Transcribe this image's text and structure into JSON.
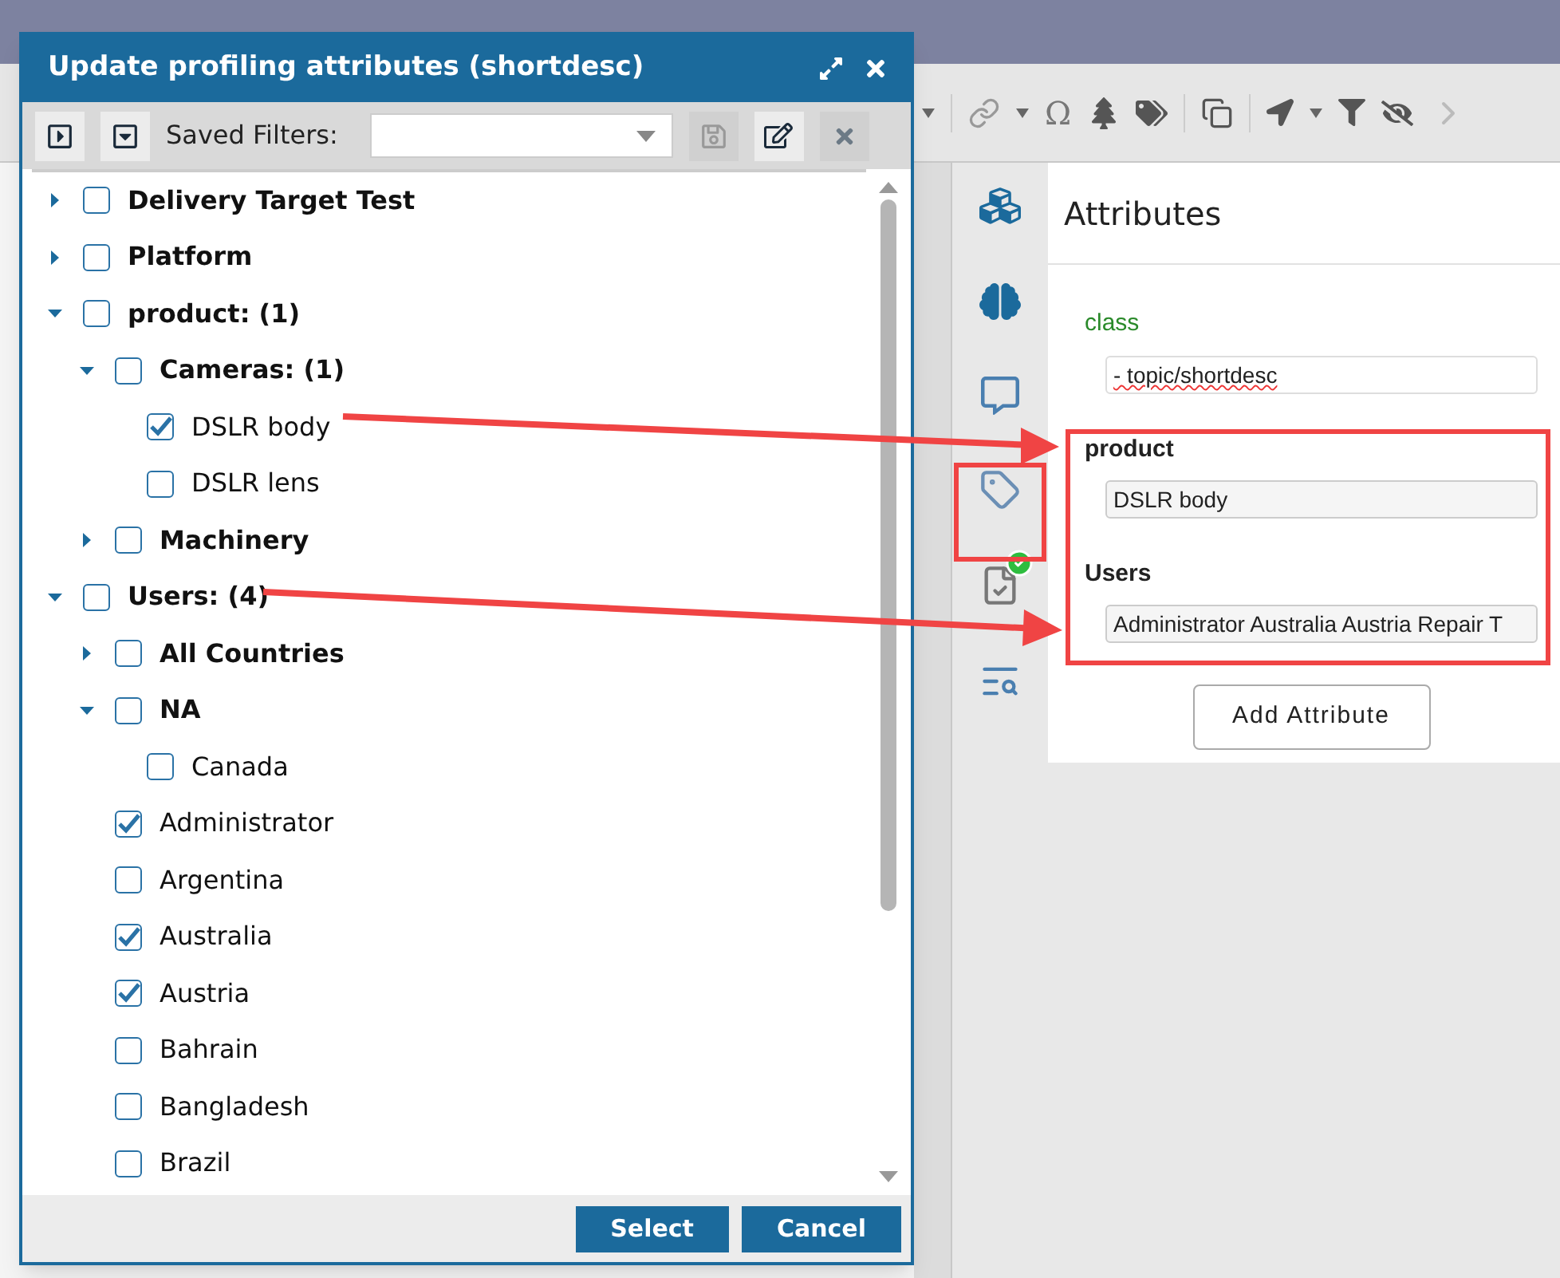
{
  "dialog": {
    "title": "Update profiling attributes (shortdesc)",
    "saved_filters_label": "Saved Filters:",
    "tree": [
      {
        "label": "Delivery Target Test",
        "kind": "group",
        "expanded": false,
        "checked": false
      },
      {
        "label": "Platform",
        "kind": "group",
        "expanded": false,
        "checked": false
      },
      {
        "label": "product: (1)",
        "kind": "group",
        "expanded": true,
        "checked": false,
        "children": [
          {
            "label": "Cameras: (1)",
            "kind": "group",
            "expanded": true,
            "checked": false,
            "children": [
              {
                "label": "DSLR body",
                "kind": "leaf",
                "checked": true
              },
              {
                "label": "DSLR lens",
                "kind": "leaf",
                "checked": false
              }
            ]
          },
          {
            "label": "Machinery",
            "kind": "group",
            "expanded": false,
            "checked": false
          }
        ]
      },
      {
        "label": "Users: (4)",
        "kind": "group",
        "expanded": true,
        "checked": false,
        "children": [
          {
            "label": "All Countries",
            "kind": "group",
            "expanded": false,
            "checked": false
          },
          {
            "label": "NA",
            "kind": "group",
            "expanded": true,
            "checked": false,
            "children": [
              {
                "label": "Canada",
                "kind": "leaf",
                "checked": false
              }
            ]
          },
          {
            "label": "Administrator",
            "kind": "leaf",
            "checked": true
          },
          {
            "label": "Argentina",
            "kind": "leaf",
            "checked": false
          },
          {
            "label": "Australia",
            "kind": "leaf",
            "checked": true
          },
          {
            "label": "Austria",
            "kind": "leaf",
            "checked": true
          },
          {
            "label": "Bahrain",
            "kind": "leaf",
            "checked": false
          },
          {
            "label": "Bangladesh",
            "kind": "leaf",
            "checked": false
          },
          {
            "label": "Brazil",
            "kind": "leaf",
            "checked": false
          }
        ]
      }
    ],
    "buttons": [
      {
        "label": "Select"
      },
      {
        "label": "Cancel"
      }
    ]
  },
  "toolbar": {
    "omega": "Ω"
  },
  "attributes_panel": {
    "title": "Attributes",
    "fields": [
      {
        "label": "class",
        "kind": "class",
        "value": "- topic/shortdesc"
      },
      {
        "label": "product",
        "kind": "profile",
        "value": "DSLR body"
      },
      {
        "label": "Users",
        "kind": "profile",
        "value": "Administrator Australia Austria Repair T"
      }
    ],
    "add_button": "Add Attribute"
  }
}
